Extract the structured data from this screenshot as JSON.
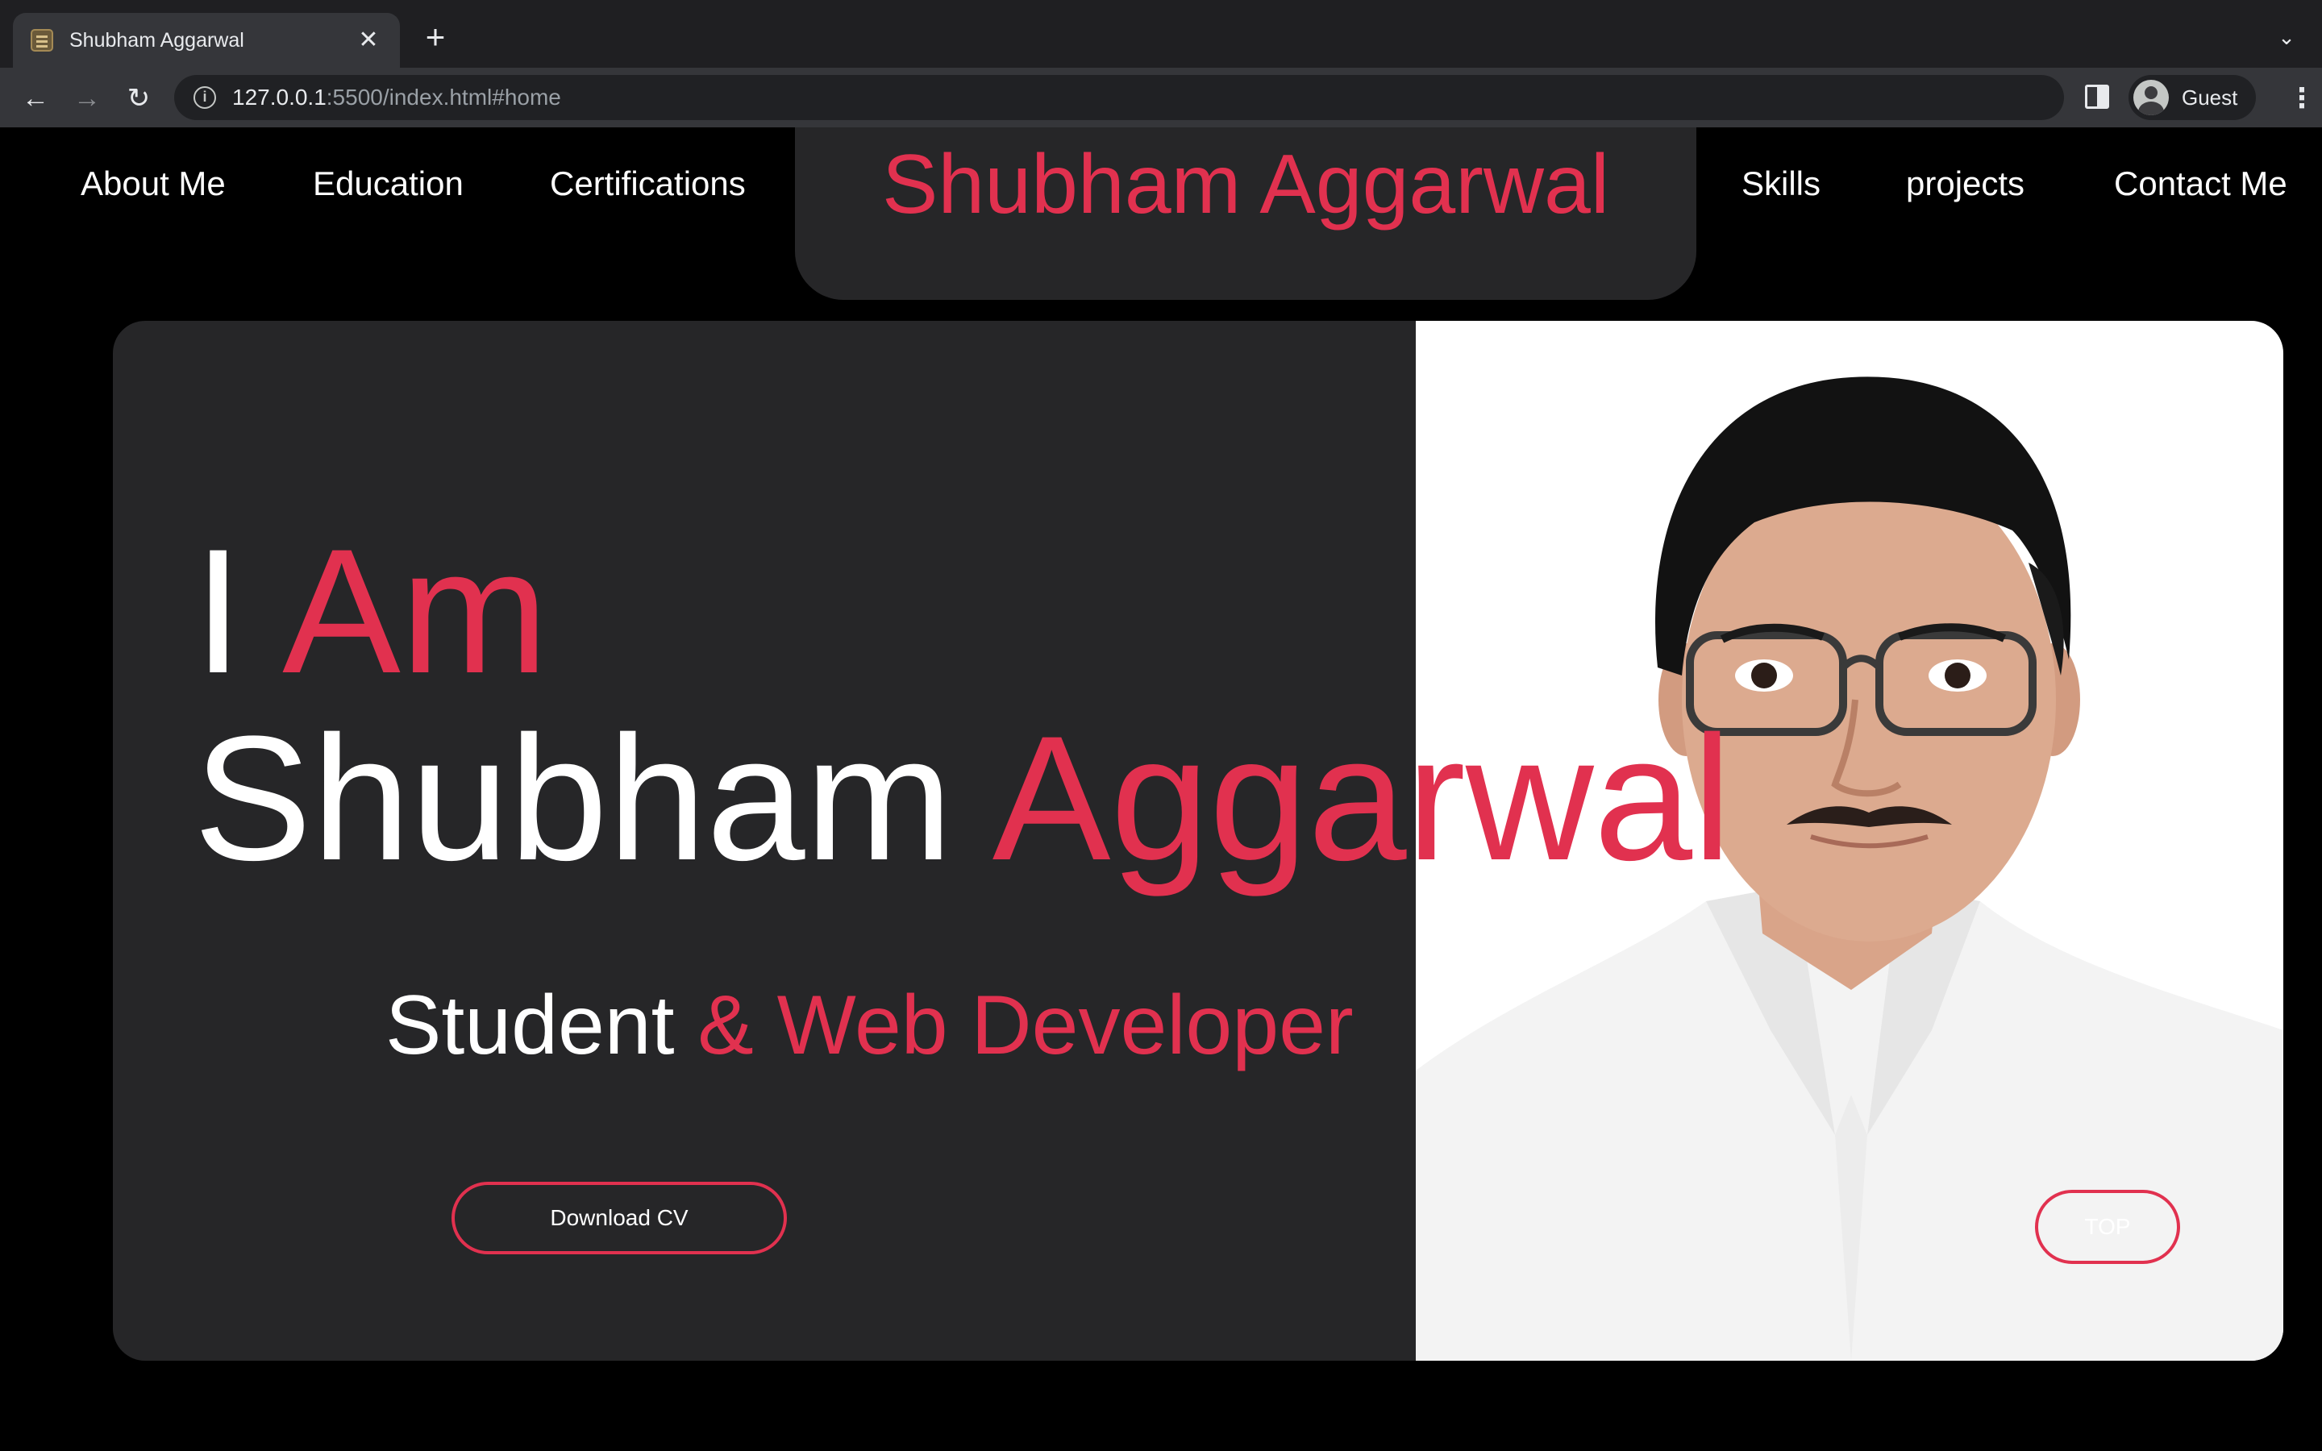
{
  "browser": {
    "tab_title": "Shubham Aggarwal",
    "tab_close": "✕",
    "new_tab": "+",
    "tab_search": "⌄",
    "url_host": "127.0.0.1",
    "url_rest": ":5500/index.html#home",
    "profile_label": "Guest",
    "back": "←",
    "forward": "→",
    "reload": "↻",
    "info": "i",
    "menu": "⋮"
  },
  "nav": {
    "items_left": [
      "About Me",
      "Education",
      "Certifications"
    ],
    "brand": "Shubham Aggarwal",
    "items_right": [
      "Skills",
      "projects",
      "Contact Me"
    ]
  },
  "hero": {
    "line1_white": "I",
    "line1_accent": "Am",
    "line2_white": "Shubham",
    "line2_accent": "Aggarwal",
    "subtitle_white": "Student",
    "subtitle_accent": "& Web Developer",
    "cv_button": "Download CV",
    "top_button": "TOP"
  },
  "colors": {
    "accent": "#e1314f",
    "panel": "#262628",
    "background": "#000000"
  }
}
